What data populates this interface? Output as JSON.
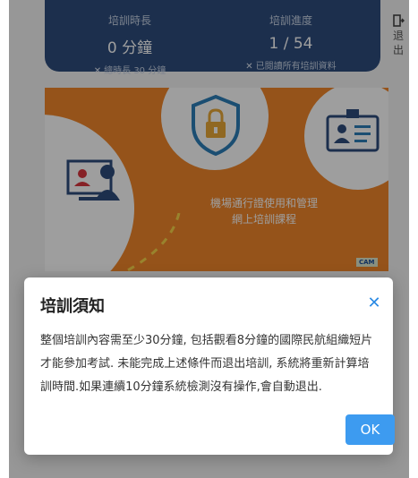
{
  "stats": {
    "duration": {
      "label": "培訓時長",
      "value": "0 分鐘",
      "note": "總時長 30 分鐘"
    },
    "progress": {
      "label": "培訓進度",
      "value": "1 / 54",
      "note": "已閱讀所有培訓資料"
    },
    "note_icon": "x-mark-icon"
  },
  "exit": {
    "label_line1": "退",
    "label_line2": "出",
    "icon": "exit-door-icon"
  },
  "banner": {
    "title_line1": "機場通行證使用和管理",
    "title_line2": "網上培訓課程",
    "logo": "CAM",
    "colors": {
      "orange": "#f0862a",
      "navy": "#2e4d7d",
      "teal": "#2c7fb8",
      "gold": "#e8a838"
    },
    "icons": [
      "shield-lock-icon",
      "id-badge-icon",
      "computer-users-icon"
    ]
  },
  "dialog": {
    "title": "培訓須知",
    "body": "整個培訓內容需至少30分鐘, 包括觀看8分鐘的國際民航組織短片才能參加考試. 未能完成上述條件而退出培訓, 系統將重新計算培訓時間.如果連續10分鐘系統檢測沒有操作,會自動退出.",
    "ok_label": "OK",
    "close_icon": "close-icon",
    "accent_color": "#3d9bf0"
  }
}
